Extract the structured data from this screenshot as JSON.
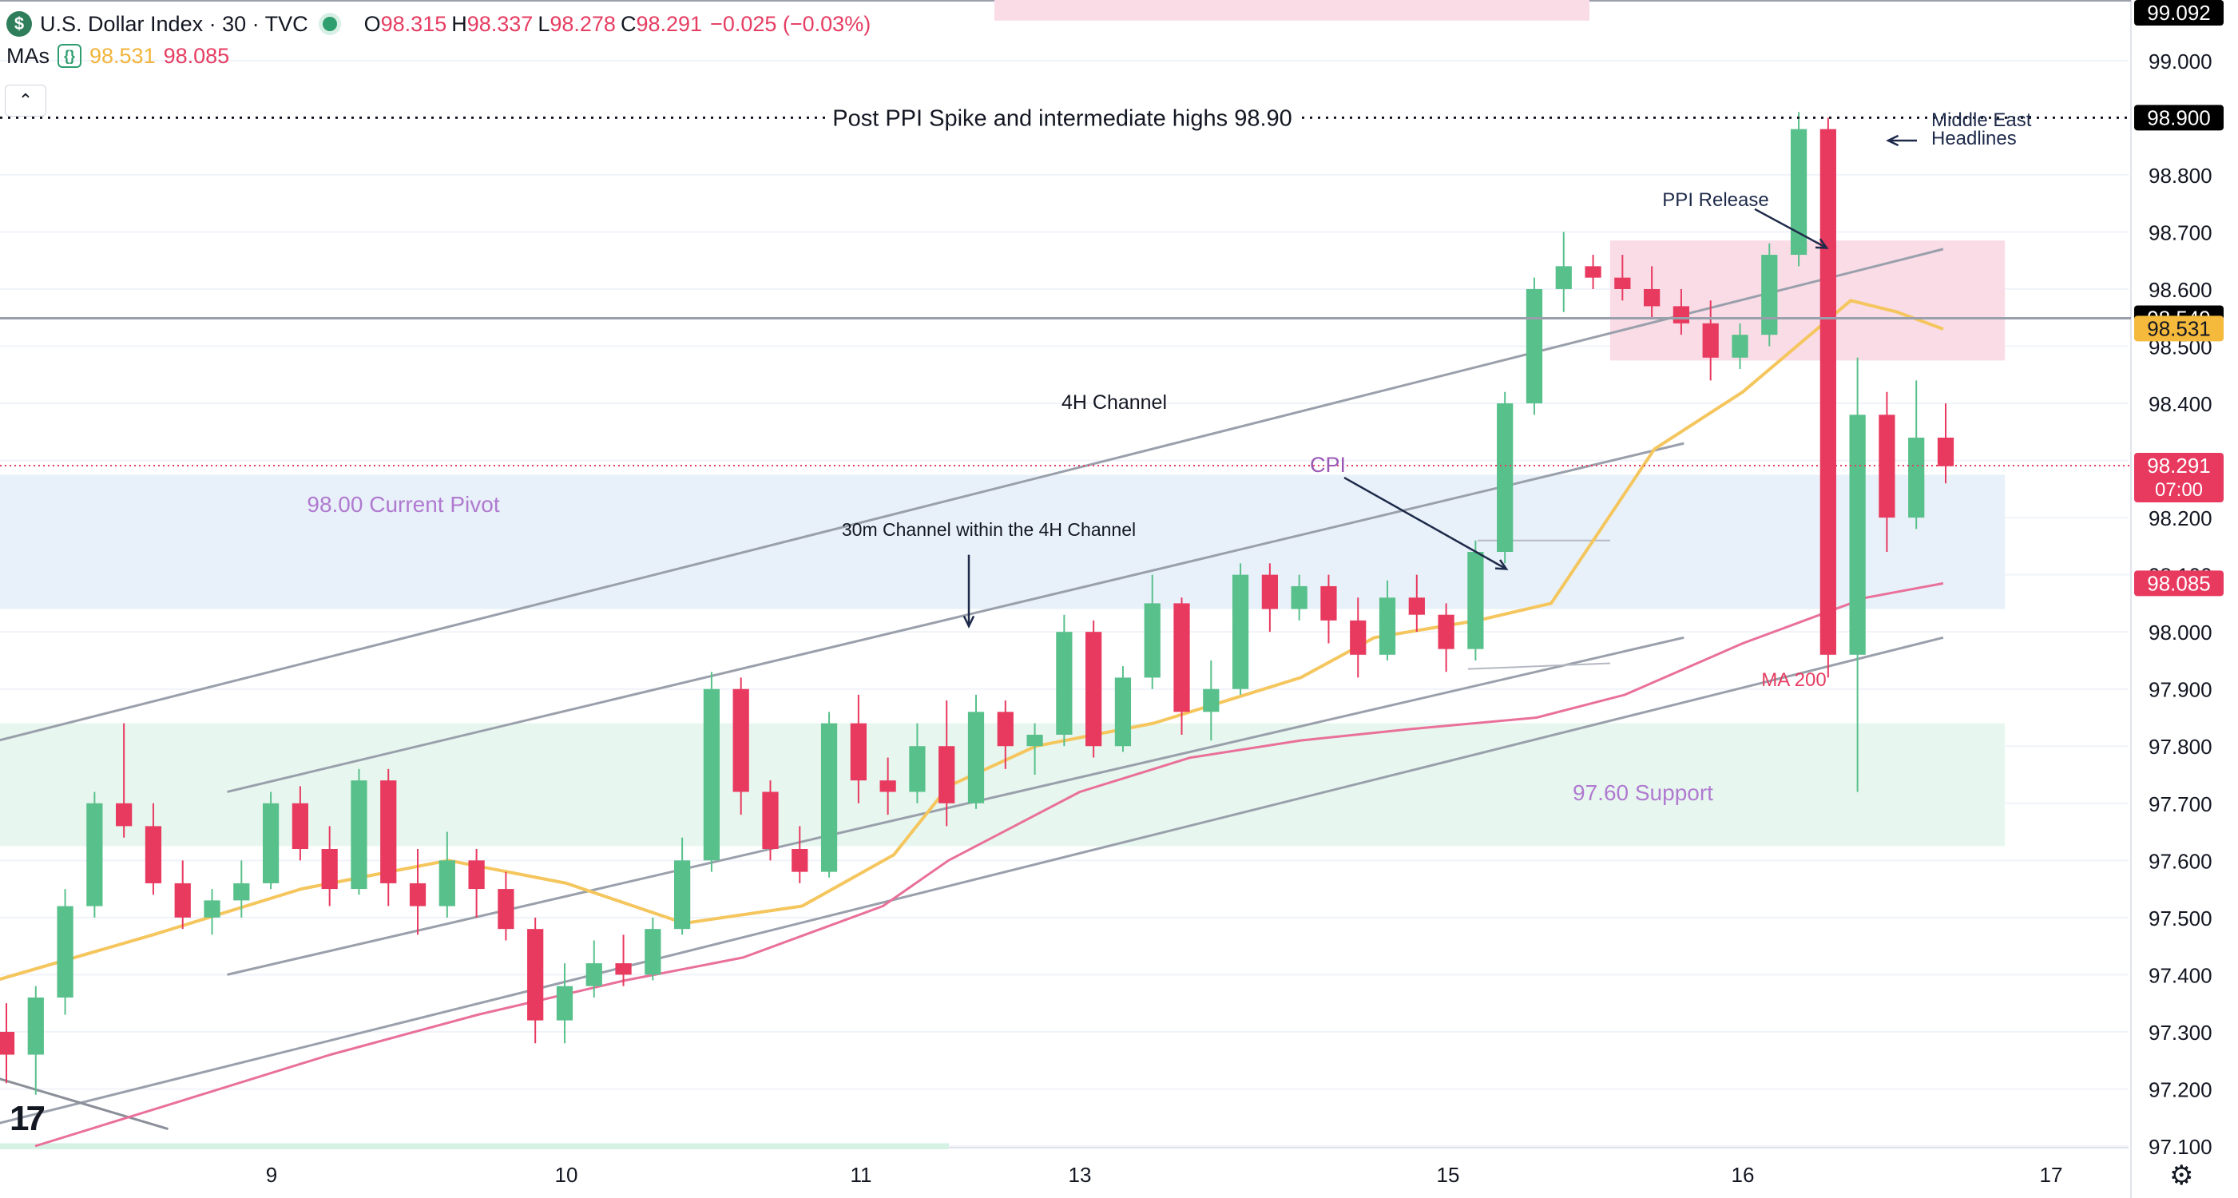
{
  "header": {
    "symbol_icon": "dollar-sign-icon",
    "symbol_glyph": "$",
    "title": "U.S. Dollar Index · 30 · TVC",
    "ohlc": [
      {
        "k": "O",
        "v": "98.315"
      },
      {
        "k": "H",
        "v": "98.337"
      },
      {
        "k": "L",
        "v": "98.278"
      },
      {
        "k": "C",
        "v": "98.291"
      }
    ],
    "change": "−0.025 (−0.03%)",
    "ma_label": "MAs",
    "ma_icon": "braces-icon",
    "ma_values": [
      "98.531",
      "98.085"
    ],
    "collapse_glyph": "⌃"
  },
  "branding": {
    "logo_text": "17",
    "settings_icon": "gear-icon",
    "settings_glyph": "⚙"
  },
  "colors": {
    "up": "#58c08b",
    "down": "#e8395f",
    "ma_fast": "#f5c65e",
    "ma_slow": "#e9709a",
    "channel": "#9aa0ab"
  },
  "chart_data": {
    "type": "candlestick",
    "title": "U.S. Dollar Index · 30 · TVC",
    "ylim": [
      97.1,
      99.092
    ],
    "x_ticks": [
      "9",
      "10",
      "11",
      "13",
      "15",
      "16",
      "17"
    ],
    "y_ticks": [
      "97.100",
      "97.200",
      "97.300",
      "97.400",
      "97.500",
      "97.600",
      "97.700",
      "97.800",
      "97.900",
      "98.000",
      "98.100",
      "98.200",
      "98.300",
      "98.400",
      "98.500",
      "98.600",
      "98.700",
      "98.800",
      "99.000"
    ],
    "price_tags": [
      {
        "label": "99.092",
        "value": 99.092,
        "style": "dark"
      },
      {
        "label": "98.900",
        "value": 98.9,
        "style": "dark"
      },
      {
        "label": "98.549",
        "value": 98.549,
        "style": "dark"
      },
      {
        "label": "98.531",
        "value": 98.531,
        "style": "ma_fast"
      },
      {
        "label": "98.291",
        "value": 98.291,
        "style": "last",
        "sub": "07:00"
      },
      {
        "label": "98.085",
        "value": 98.085,
        "style": "ma_slow"
      }
    ],
    "horizontal_lines": [
      {
        "value": 98.9,
        "style": "dotted",
        "label": "Post PPI Spike and intermediate highs 98.90"
      },
      {
        "value": 98.549,
        "style": "solid"
      },
      {
        "value": 98.291,
        "style": "last-price"
      }
    ],
    "zones": [
      {
        "label": "",
        "x": [
          15.55,
          16.85
        ],
        "y": [
          98.475,
          98.685
        ],
        "color": "#f9dce6"
      },
      {
        "label": "98.00 Current Pivot",
        "x": [
          8.0,
          16.85
        ],
        "y": [
          98.04,
          98.275
        ],
        "color": "#e8f1f9"
      },
      {
        "label": "97.60 Support",
        "x": [
          8.0,
          16.85
        ],
        "y": [
          97.625,
          97.84
        ],
        "color": "#e7f7ef"
      }
    ],
    "annotations": [
      {
        "text": "4H Channel",
        "x": 13.1,
        "y": 98.39,
        "color": "#131722"
      },
      {
        "text": "30m Channel within the 4H Channel",
        "x": 12.3,
        "y": 98.17,
        "color": "#131722"
      },
      {
        "text": "CPI",
        "x": 14.6,
        "y": 98.29,
        "color": "#9b59b6"
      },
      {
        "text": "PPI Release",
        "x": 15.85,
        "y": 98.745,
        "color": "#1e2a4a"
      },
      {
        "text": "Middle East",
        "x": 16.65,
        "y": 98.88,
        "color": "#1e2a4a"
      },
      {
        "text": "Headlines",
        "x": 16.65,
        "y": 98.845,
        "color": "#1e2a4a"
      },
      {
        "text": "MA 200",
        "x": 16.2,
        "y": 97.905,
        "color": "#e53d62"
      }
    ],
    "trendlines": [
      {
        "x": [
          8.0,
          16.65
        ],
        "y": [
          97.8,
          98.67
        ]
      },
      {
        "x": [
          8.85,
          15.8
        ],
        "y": [
          97.72,
          98.33
        ]
      },
      {
        "x": [
          8.85,
          15.8
        ],
        "y": [
          97.4,
          97.99
        ]
      },
      {
        "x": [
          8.0,
          16.65
        ],
        "y": [
          97.13,
          97.99
        ]
      },
      {
        "x": [
          8.0,
          8.65
        ],
        "y": [
          97.23,
          97.13
        ]
      }
    ],
    "ma_fast": {
      "x": [
        8.0,
        8.6,
        9.1,
        9.6,
        10.0,
        10.4,
        10.8,
        11.3,
        11.8,
        12.6,
        13.4,
        14.2,
        14.6,
        15.1,
        15.35,
        15.7,
        16.0,
        16.35,
        16.5,
        16.65
      ],
      "y": [
        97.38,
        97.47,
        97.55,
        97.6,
        97.56,
        97.49,
        97.52,
        97.61,
        97.73,
        97.8,
        97.84,
        97.92,
        97.99,
        98.02,
        98.05,
        98.32,
        98.42,
        98.58,
        98.56,
        98.53
      ]
    },
    "ma_slow": {
      "x": [
        8.2,
        8.7,
        9.2,
        9.7,
        10.2,
        10.6,
        11.2,
        11.8,
        12.4,
        13.0,
        13.6,
        14.2,
        14.8,
        15.3,
        15.6,
        16.0,
        16.4,
        16.65
      ],
      "y": [
        97.1,
        97.18,
        97.26,
        97.33,
        97.39,
        97.43,
        97.52,
        97.6,
        97.66,
        97.72,
        97.78,
        97.81,
        97.83,
        97.85,
        97.89,
        97.98,
        98.06,
        98.085
      ]
    },
    "ohlc": [
      [
        97.3,
        97.35,
        97.21,
        97.26
      ],
      [
        97.26,
        97.38,
        97.19,
        97.36
      ],
      [
        97.36,
        97.55,
        97.33,
        97.52
      ],
      [
        97.52,
        97.72,
        97.5,
        97.7
      ],
      [
        97.7,
        97.84,
        97.64,
        97.66
      ],
      [
        97.66,
        97.7,
        97.54,
        97.56
      ],
      [
        97.56,
        97.6,
        97.48,
        97.5
      ],
      [
        97.5,
        97.55,
        97.47,
        97.53
      ],
      [
        97.53,
        97.6,
        97.5,
        97.56
      ],
      [
        97.56,
        97.72,
        97.55,
        97.7
      ],
      [
        97.7,
        97.73,
        97.6,
        97.62
      ],
      [
        97.62,
        97.66,
        97.52,
        97.55
      ],
      [
        97.55,
        97.76,
        97.54,
        97.74
      ],
      [
        97.74,
        97.76,
        97.52,
        97.56
      ],
      [
        97.56,
        97.62,
        97.47,
        97.52
      ],
      [
        97.52,
        97.65,
        97.5,
        97.6
      ],
      [
        97.6,
        97.62,
        97.5,
        97.55
      ],
      [
        97.55,
        97.58,
        97.46,
        97.48
      ],
      [
        97.48,
        97.5,
        97.28,
        97.32
      ],
      [
        97.32,
        97.42,
        97.28,
        97.38
      ],
      [
        97.38,
        97.46,
        97.36,
        97.42
      ],
      [
        97.42,
        97.47,
        97.38,
        97.4
      ],
      [
        97.4,
        97.5,
        97.39,
        97.48
      ],
      [
        97.48,
        97.64,
        97.47,
        97.6
      ],
      [
        97.6,
        97.93,
        97.58,
        97.9
      ],
      [
        97.9,
        97.92,
        97.68,
        97.72
      ],
      [
        97.72,
        97.74,
        97.6,
        97.62
      ],
      [
        97.62,
        97.66,
        97.56,
        97.58
      ],
      [
        97.58,
        97.86,
        97.57,
        97.84
      ],
      [
        97.84,
        97.89,
        97.7,
        97.74
      ],
      [
        97.74,
        97.78,
        97.68,
        97.72
      ],
      [
        97.72,
        97.84,
        97.7,
        97.8
      ],
      [
        97.8,
        97.88,
        97.66,
        97.7
      ],
      [
        97.7,
        97.89,
        97.69,
        97.86
      ],
      [
        97.86,
        97.88,
        97.76,
        97.8
      ],
      [
        97.8,
        97.84,
        97.75,
        97.82
      ],
      [
        97.82,
        98.03,
        97.8,
        98.0
      ],
      [
        98.0,
        98.02,
        97.78,
        97.8
      ],
      [
        97.8,
        97.94,
        97.79,
        97.92
      ],
      [
        97.92,
        98.1,
        97.9,
        98.05
      ],
      [
        98.05,
        98.06,
        97.82,
        97.86
      ],
      [
        97.86,
        97.95,
        97.81,
        97.9
      ],
      [
        97.9,
        98.12,
        97.89,
        98.1
      ],
      [
        98.1,
        98.12,
        98.0,
        98.04
      ],
      [
        98.04,
        98.1,
        98.02,
        98.08
      ],
      [
        98.08,
        98.1,
        97.98,
        98.02
      ],
      [
        98.02,
        98.06,
        97.92,
        97.96
      ],
      [
        97.96,
        98.09,
        97.95,
        98.06
      ],
      [
        98.06,
        98.1,
        98.0,
        98.03
      ],
      [
        98.03,
        98.05,
        97.93,
        97.97
      ],
      [
        97.97,
        98.16,
        97.95,
        98.14
      ],
      [
        98.14,
        98.42,
        98.12,
        98.4
      ],
      [
        98.4,
        98.62,
        98.38,
        98.6
      ],
      [
        98.6,
        98.7,
        98.56,
        98.64
      ],
      [
        98.64,
        98.66,
        98.6,
        98.62
      ],
      [
        98.62,
        98.66,
        98.58,
        98.6
      ],
      [
        98.6,
        98.64,
        98.55,
        98.57
      ],
      [
        98.57,
        98.6,
        98.52,
        98.54
      ],
      [
        98.54,
        98.58,
        98.44,
        98.48
      ],
      [
        98.48,
        98.54,
        98.46,
        98.52
      ],
      [
        98.52,
        98.68,
        98.5,
        98.66
      ],
      [
        98.66,
        98.91,
        98.64,
        98.88
      ],
      [
        98.88,
        98.9,
        97.92,
        97.96
      ],
      [
        97.96,
        98.48,
        97.72,
        98.38
      ],
      [
        98.38,
        98.42,
        98.14,
        98.2
      ],
      [
        98.2,
        98.44,
        98.18,
        98.34
      ],
      [
        98.34,
        98.4,
        98.26,
        98.29
      ]
    ]
  }
}
